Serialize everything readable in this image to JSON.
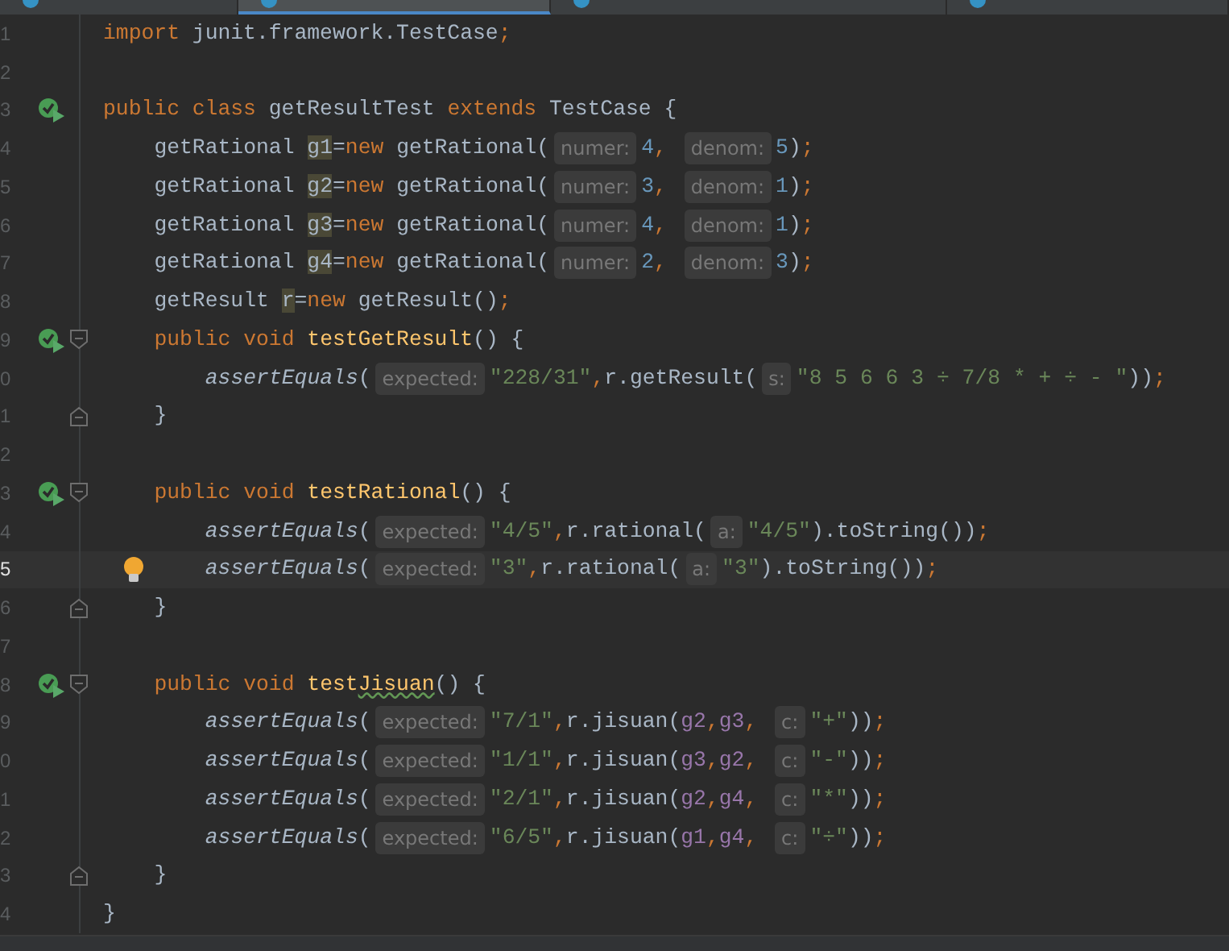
{
  "tabs": [
    {
      "selected": false
    },
    {
      "selected": true
    },
    {
      "selected": false
    },
    {
      "selected": false
    }
  ],
  "lines": [
    {
      "number": "1",
      "run_icon": false,
      "fold_start": false,
      "fold_end": false,
      "bulb": false,
      "current": false,
      "tokens": [
        {
          "kind": "kw",
          "text": "import "
        },
        {
          "kind": "plain",
          "text": "junit.framework.TestCase"
        },
        {
          "kind": "kw",
          "text": ";"
        }
      ]
    },
    {
      "number": "2",
      "run_icon": false,
      "fold_start": false,
      "fold_end": false,
      "bulb": false,
      "current": false
    },
    {
      "number": "3",
      "run_icon": true,
      "fold_start": false,
      "fold_end": false,
      "bulb": false,
      "current": false,
      "tokens": [
        {
          "kind": "kw",
          "text": "public class "
        },
        {
          "kind": "plain",
          "text": "getResultTest "
        },
        {
          "kind": "kw",
          "text": "extends "
        },
        {
          "kind": "plain",
          "text": "TestCase {"
        }
      ]
    },
    {
      "number": "4",
      "run_icon": false,
      "fold_start": false,
      "fold_end": false,
      "bulb": false,
      "current": false,
      "tokens": [
        {
          "kind": "plain",
          "text": "getRational "
        },
        {
          "kind": "usage",
          "text": "g1"
        },
        {
          "kind": "plain",
          "text": "="
        },
        {
          "kind": "kw",
          "text": "new "
        },
        {
          "kind": "plain",
          "text": "getRational("
        },
        {
          "kind": "hint",
          "text": "numer:"
        },
        {
          "kind": "num",
          "text": "4"
        },
        {
          "kind": "kw",
          "text": ", "
        },
        {
          "kind": "hint",
          "text": "denom:"
        },
        {
          "kind": "num",
          "text": "5"
        },
        {
          "kind": "plain",
          "text": ")"
        },
        {
          "kind": "kw",
          "text": ";"
        }
      ]
    },
    {
      "number": "5",
      "run_icon": false,
      "fold_start": false,
      "fold_end": false,
      "bulb": false,
      "current": false,
      "tokens": [
        {
          "kind": "plain",
          "text": "getRational "
        },
        {
          "kind": "usage",
          "text": "g2"
        },
        {
          "kind": "plain",
          "text": "="
        },
        {
          "kind": "kw",
          "text": "new "
        },
        {
          "kind": "plain",
          "text": "getRational("
        },
        {
          "kind": "hint",
          "text": "numer:"
        },
        {
          "kind": "num",
          "text": "3"
        },
        {
          "kind": "kw",
          "text": ", "
        },
        {
          "kind": "hint",
          "text": "denom:"
        },
        {
          "kind": "num",
          "text": "1"
        },
        {
          "kind": "plain",
          "text": ")"
        },
        {
          "kind": "kw",
          "text": ";"
        }
      ]
    },
    {
      "number": "6",
      "run_icon": false,
      "fold_start": false,
      "fold_end": false,
      "bulb": false,
      "current": false,
      "tokens": [
        {
          "kind": "plain",
          "text": "getRational "
        },
        {
          "kind": "usage",
          "text": "g3"
        },
        {
          "kind": "plain",
          "text": "="
        },
        {
          "kind": "kw",
          "text": "new "
        },
        {
          "kind": "plain",
          "text": "getRational("
        },
        {
          "kind": "hint",
          "text": "numer:"
        },
        {
          "kind": "num",
          "text": "4"
        },
        {
          "kind": "kw",
          "text": ", "
        },
        {
          "kind": "hint",
          "text": "denom:"
        },
        {
          "kind": "num",
          "text": "1"
        },
        {
          "kind": "plain",
          "text": ")"
        },
        {
          "kind": "kw",
          "text": ";"
        }
      ]
    },
    {
      "number": "7",
      "run_icon": false,
      "fold_start": false,
      "fold_end": false,
      "bulb": false,
      "current": false,
      "tokens": [
        {
          "kind": "plain",
          "text": "getRational "
        },
        {
          "kind": "usage",
          "text": "g4"
        },
        {
          "kind": "plain",
          "text": "="
        },
        {
          "kind": "kw",
          "text": "new "
        },
        {
          "kind": "plain",
          "text": "getRational("
        },
        {
          "kind": "hint",
          "text": "numer:"
        },
        {
          "kind": "num",
          "text": "2"
        },
        {
          "kind": "kw",
          "text": ", "
        },
        {
          "kind": "hint",
          "text": "denom:"
        },
        {
          "kind": "num",
          "text": "3"
        },
        {
          "kind": "plain",
          "text": ")"
        },
        {
          "kind": "kw",
          "text": ";"
        }
      ]
    },
    {
      "number": "8",
      "run_icon": false,
      "fold_start": false,
      "fold_end": false,
      "bulb": false,
      "current": false,
      "tokens": [
        {
          "kind": "plain",
          "text": "getResult "
        },
        {
          "kind": "usage",
          "text": "r"
        },
        {
          "kind": "plain",
          "text": "="
        },
        {
          "kind": "kw",
          "text": "new "
        },
        {
          "kind": "plain",
          "text": "getResult()"
        },
        {
          "kind": "kw",
          "text": ";"
        }
      ]
    },
    {
      "number": "9",
      "run_icon": true,
      "fold_start": true,
      "fold_end": false,
      "bulb": false,
      "current": false,
      "tokens": [
        {
          "kind": "kw",
          "text": "public void "
        },
        {
          "kind": "decl",
          "text": "testGetResult"
        },
        {
          "kind": "plain",
          "text": "() {"
        }
      ]
    },
    {
      "number": "0",
      "run_icon": false,
      "fold_start": false,
      "fold_end": false,
      "bulb": false,
      "current": false,
      "tokens": [
        {
          "kind": "static",
          "text": "assertEquals"
        },
        {
          "kind": "plain",
          "text": "("
        },
        {
          "kind": "hint",
          "text": "expected:"
        },
        {
          "kind": "str",
          "text": "\"228/31\""
        },
        {
          "kind": "kw",
          "text": ","
        },
        {
          "kind": "plain",
          "text": "r.getResult("
        },
        {
          "kind": "hint",
          "text": "s:"
        },
        {
          "kind": "str",
          "text": "\"8 5 6 6 3 ÷ 7/8 * + ÷ - \""
        },
        {
          "kind": "plain",
          "text": "))"
        },
        {
          "kind": "kw",
          "text": ";"
        }
      ]
    },
    {
      "number": "1",
      "run_icon": false,
      "fold_start": false,
      "fold_end": true,
      "bulb": false,
      "current": false,
      "tokens": [
        {
          "kind": "plain",
          "text": "}"
        }
      ]
    },
    {
      "number": "2",
      "run_icon": false,
      "fold_start": false,
      "fold_end": false,
      "bulb": false,
      "current": false
    },
    {
      "number": "3",
      "run_icon": true,
      "fold_start": true,
      "fold_end": false,
      "bulb": false,
      "current": false,
      "tokens": [
        {
          "kind": "kw",
          "text": "public void "
        },
        {
          "kind": "decl",
          "text": "testRational"
        },
        {
          "kind": "plain",
          "text": "() {"
        }
      ]
    },
    {
      "number": "4",
      "run_icon": false,
      "fold_start": false,
      "fold_end": false,
      "bulb": false,
      "current": false,
      "tokens": [
        {
          "kind": "static",
          "text": "assertEquals"
        },
        {
          "kind": "plain",
          "text": "("
        },
        {
          "kind": "hint",
          "text": "expected:"
        },
        {
          "kind": "str",
          "text": "\"4/5\""
        },
        {
          "kind": "kw",
          "text": ","
        },
        {
          "kind": "plain",
          "text": "r.rational("
        },
        {
          "kind": "hint",
          "text": "a:"
        },
        {
          "kind": "str",
          "text": "\"4/5\""
        },
        {
          "kind": "plain",
          "text": ").toString())"
        },
        {
          "kind": "kw",
          "text": ";"
        }
      ]
    },
    {
      "number": "5",
      "run_icon": false,
      "fold_start": false,
      "fold_end": false,
      "bulb": true,
      "current": true,
      "tokens": [
        {
          "kind": "static",
          "text": "assertEquals"
        },
        {
          "kind": "plain",
          "text": "("
        },
        {
          "kind": "hint",
          "text": "expected:"
        },
        {
          "kind": "str",
          "text": "\"3\""
        },
        {
          "kind": "kw",
          "text": ","
        },
        {
          "kind": "plain",
          "text": "r.rational("
        },
        {
          "kind": "hint",
          "text": "a:"
        },
        {
          "kind": "str",
          "text": "\"3\""
        },
        {
          "kind": "plain",
          "text": ").toString())"
        },
        {
          "kind": "kw",
          "text": ";"
        }
      ]
    },
    {
      "number": "6",
      "run_icon": false,
      "fold_start": false,
      "fold_end": true,
      "bulb": false,
      "current": false,
      "tokens": [
        {
          "kind": "plain",
          "text": "}"
        }
      ]
    },
    {
      "number": "7",
      "run_icon": false,
      "fold_start": false,
      "fold_end": false,
      "bulb": false,
      "current": false
    },
    {
      "number": "8",
      "run_icon": true,
      "fold_start": true,
      "fold_end": false,
      "bulb": false,
      "current": false,
      "tokens": [
        {
          "kind": "kw",
          "text": "public void "
        },
        {
          "kind": "decl",
          "text": "test"
        },
        {
          "kind": "typo",
          "text": "Jisuan"
        },
        {
          "kind": "plain",
          "text": "() {"
        }
      ]
    },
    {
      "number": "9",
      "run_icon": false,
      "fold_start": false,
      "fold_end": false,
      "bulb": false,
      "current": false,
      "tokens": [
        {
          "kind": "static",
          "text": "assertEquals"
        },
        {
          "kind": "plain",
          "text": "("
        },
        {
          "kind": "hint",
          "text": "expected:"
        },
        {
          "kind": "str",
          "text": "\"7/1\""
        },
        {
          "kind": "kw",
          "text": ","
        },
        {
          "kind": "plain",
          "text": "r.jisuan("
        },
        {
          "kind": "field",
          "text": "g2"
        },
        {
          "kind": "kw",
          "text": ","
        },
        {
          "kind": "field",
          "text": "g3"
        },
        {
          "kind": "kw",
          "text": ", "
        },
        {
          "kind": "hint",
          "text": "c:"
        },
        {
          "kind": "str",
          "text": "\"+\""
        },
        {
          "kind": "plain",
          "text": "))"
        },
        {
          "kind": "kw",
          "text": ";"
        }
      ]
    },
    {
      "number": "0",
      "run_icon": false,
      "fold_start": false,
      "fold_end": false,
      "bulb": false,
      "current": false,
      "tokens": [
        {
          "kind": "static",
          "text": "assertEquals"
        },
        {
          "kind": "plain",
          "text": "("
        },
        {
          "kind": "hint",
          "text": "expected:"
        },
        {
          "kind": "str",
          "text": "\"1/1\""
        },
        {
          "kind": "kw",
          "text": ","
        },
        {
          "kind": "plain",
          "text": "r.jisuan("
        },
        {
          "kind": "field",
          "text": "g3"
        },
        {
          "kind": "kw",
          "text": ","
        },
        {
          "kind": "field",
          "text": "g2"
        },
        {
          "kind": "kw",
          "text": ", "
        },
        {
          "kind": "hint",
          "text": "c:"
        },
        {
          "kind": "str",
          "text": "\"-\""
        },
        {
          "kind": "plain",
          "text": "))"
        },
        {
          "kind": "kw",
          "text": ";"
        }
      ]
    },
    {
      "number": "1",
      "run_icon": false,
      "fold_start": false,
      "fold_end": false,
      "bulb": false,
      "current": false,
      "tokens": [
        {
          "kind": "static",
          "text": "assertEquals"
        },
        {
          "kind": "plain",
          "text": "("
        },
        {
          "kind": "hint",
          "text": "expected:"
        },
        {
          "kind": "str",
          "text": "\"2/1\""
        },
        {
          "kind": "kw",
          "text": ","
        },
        {
          "kind": "plain",
          "text": "r.jisuan("
        },
        {
          "kind": "field",
          "text": "g2"
        },
        {
          "kind": "kw",
          "text": ","
        },
        {
          "kind": "field",
          "text": "g4"
        },
        {
          "kind": "kw",
          "text": ", "
        },
        {
          "kind": "hint",
          "text": "c:"
        },
        {
          "kind": "str",
          "text": "\"*\""
        },
        {
          "kind": "plain",
          "text": "))"
        },
        {
          "kind": "kw",
          "text": ";"
        }
      ]
    },
    {
      "number": "2",
      "run_icon": false,
      "fold_start": false,
      "fold_end": false,
      "bulb": false,
      "current": false,
      "tokens": [
        {
          "kind": "static",
          "text": "assertEquals"
        },
        {
          "kind": "plain",
          "text": "("
        },
        {
          "kind": "hint",
          "text": "expected:"
        },
        {
          "kind": "str",
          "text": "\"6/5\""
        },
        {
          "kind": "kw",
          "text": ","
        },
        {
          "kind": "plain",
          "text": "r.jisuan("
        },
        {
          "kind": "field",
          "text": "g1"
        },
        {
          "kind": "kw",
          "text": ","
        },
        {
          "kind": "field",
          "text": "g4"
        },
        {
          "kind": "kw",
          "text": ", "
        },
        {
          "kind": "hint",
          "text": "c:"
        },
        {
          "kind": "str",
          "text": "\"÷\""
        },
        {
          "kind": "plain",
          "text": "))"
        },
        {
          "kind": "kw",
          "text": ";"
        }
      ]
    },
    {
      "number": "3",
      "run_icon": false,
      "fold_start": false,
      "fold_end": true,
      "bulb": false,
      "current": false,
      "tokens": [
        {
          "kind": "plain",
          "text": "}"
        }
      ]
    },
    {
      "number": "4",
      "run_icon": false,
      "fold_start": false,
      "fold_end": false,
      "bulb": false,
      "current": false,
      "tokens": [
        {
          "kind": "plain",
          "text": "}"
        }
      ]
    }
  ]
}
